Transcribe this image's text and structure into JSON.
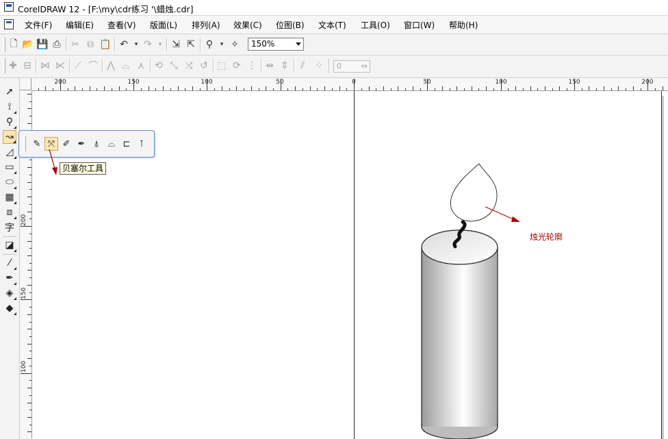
{
  "window": {
    "title": "CorelDRAW 12 - [F:\\my\\cdr练习  '\\蜡烛.cdr]"
  },
  "menu": {
    "items": [
      "文件(F)",
      "编辑(E)",
      "查看(V)",
      "版面(L)",
      "排列(A)",
      "效果(C)",
      "位图(B)",
      "文本(T)",
      "工具(O)",
      "窗口(W)",
      "帮助(H)"
    ]
  },
  "toolbar": {
    "zoom_value": "150%",
    "nudge_value": "0"
  },
  "ruler": {
    "top_labels": [
      "200",
      "150",
      "100",
      "50",
      "0",
      "50",
      "100",
      "150",
      "200"
    ],
    "left_labels": [
      "200",
      "150",
      "100"
    ]
  },
  "flyout": {
    "tooltip": "贝塞尔工具"
  },
  "canvas": {
    "annotation": "烛光轮廓"
  },
  "colors": {
    "accent": "#c7a45a",
    "annotation": "#a00000",
    "arrow": "#b00000",
    "flyout_border": "#6b8fc2"
  }
}
